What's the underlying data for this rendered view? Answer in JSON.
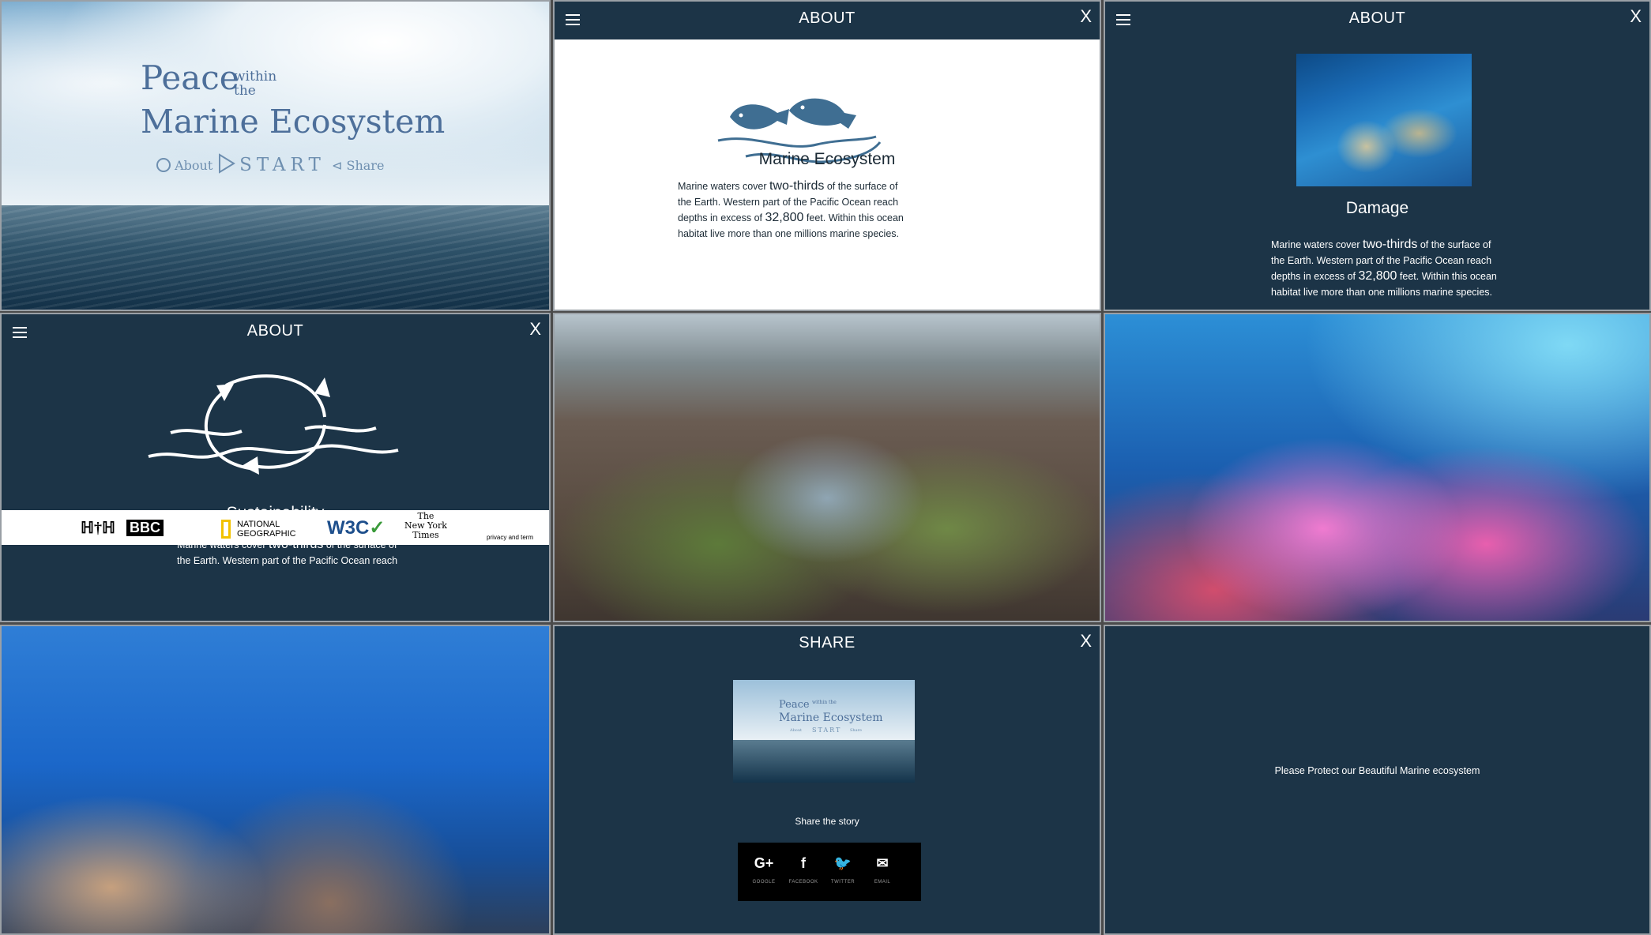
{
  "hero": {
    "peace": "Peace",
    "within": "within",
    "the": "the",
    "marine": "Marine Ecosystem",
    "about": "About",
    "start": "START",
    "share": "Share"
  },
  "panel_about_1": {
    "header_title": "ABOUT",
    "close": "X",
    "heading": "Marine Ecosystem",
    "line1_a": "Marine waters cover ",
    "line1_b": "two-thirds",
    "line1_c": " of the surface of",
    "line2": "the Earth.     Western part of the Pacific Ocean reach",
    "line3_a": "depths in  excess of ",
    "line3_b": "32,800",
    "line3_c": " feet. Within this ocean",
    "line4": "habitat  live  more than one millions marine species."
  },
  "panel_about_2": {
    "header_title": "ABOUT",
    "close": "X",
    "heading": "Damage",
    "line1_a": "Marine waters cover ",
    "line1_b": "two-thirds",
    "line1_c": " of the surface of",
    "line2": "the Earth.     Western part of the Pacific Ocean reach",
    "line3_a": "depths in  excess of ",
    "line3_b": "32,800",
    "line3_c": " feet. Within this ocean",
    "line4": "habitat  live  more than one millions marine species."
  },
  "panel_about_3": {
    "header_title": "ABOUT",
    "close": "X",
    "heading": "Sustainability",
    "line1_a": "Marine waters cover ",
    "line1_b": "two-thirds",
    "line1_c": " of the surface of",
    "line2": "the Earth.     Western part of the Pacific Ocean reach",
    "logos": {
      "bbc": "BBC",
      "natgeo_1": "NATIONAL",
      "natgeo_2": "GEOGRAPHIC",
      "w3c": "W3C",
      "nyt_1": "The",
      "nyt_2": "New York",
      "nyt_3": "Times",
      "privacy": "privacy and term"
    }
  },
  "panel_share": {
    "header_title": "SHARE",
    "close": "X",
    "thumb_peace": "Peace",
    "thumb_within": "within the",
    "thumb_marine": "Marine Ecosystem",
    "thumb_about": "About",
    "thumb_start": "START",
    "thumb_share": "Share",
    "caption": "Share the story",
    "buttons": [
      {
        "icon": "G+",
        "label": "GOOGLE"
      },
      {
        "icon": "f",
        "label": "FACEBOOK"
      },
      {
        "icon": "🐦",
        "label": "TWITTER"
      },
      {
        "icon": "✉",
        "label": "EMAIL"
      }
    ]
  },
  "panel_final": {
    "message": "Please Protect our Beautiful Marine ecosystem"
  }
}
